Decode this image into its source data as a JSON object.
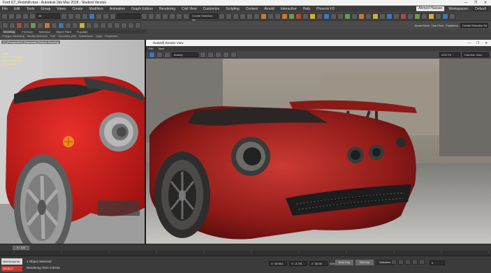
{
  "window": {
    "title": "Ford GT_Redshift.max - Autodesk 3ds Max 2018 - Student Version",
    "buttons": [
      "—",
      "❐",
      "✕"
    ]
  },
  "menu": {
    "items": [
      "File",
      "Edit",
      "Tools",
      "Group",
      "Views",
      "Create",
      "Modifiers",
      "Animation",
      "Graph Editors",
      "Rendering",
      "Civil View",
      "Customize",
      "Scripting",
      "Content",
      "Arnold",
      "Interactive",
      "Help",
      "Phoenix FD"
    ],
    "user": "Ahmed Hassan",
    "workspaces_label": "Workspaces:",
    "workspace": "Default"
  },
  "toolbar": {
    "selection_filter": "All",
    "view_dropdown": "Create Selection Se"
  },
  "toolbar2": {
    "right_labels": [
      "Smart Move",
      "Use Pivot",
      "PolyMenu"
    ],
    "selection_set": "Create Selection Se"
  },
  "ribbon": {
    "tabs": [
      "Modeling",
      "Freeform",
      "Selection",
      "Object Paint",
      "Populate"
    ],
    "sub": [
      "Polygon Modeling",
      "Modify Selection",
      "Edit",
      "Geometry (All)",
      "Subdivision",
      "Align",
      "Properties"
    ]
  },
  "left_viewport": {
    "label": "[+] [Perspective] [Standard] [Default Shading]",
    "stats": [
      "Total",
      "Polys: 4,185,963",
      "Verts: 2,186,451",
      "FPS: 3.911"
    ]
  },
  "render_window": {
    "title": "Redshift Render View",
    "buttons": [
      "—",
      "❐",
      "✕"
    ],
    "menu": [
      "File",
      "View"
    ],
    "dropdown_left": "Beauty",
    "dropdown_right1": "AOV Fit",
    "dropdown_right2": "Camera: Cam"
  },
  "timeline": {
    "slider": "0 / 100"
  },
  "status": {
    "maxscript": "MAXScript Mi",
    "maxscript_red": "OBJECT",
    "line1": "1 Object Selected",
    "line2": "Rendering Time  0:00:01",
    "x": "X: 35.664",
    "y": "Y: -3.791",
    "z": "Z: 26.08",
    "grid": "Grid = 10.0",
    "autokey": "Auto Key",
    "setkey": "Set Key",
    "selected": "Selected",
    "frame": "0"
  },
  "colors": {
    "accent": "#3d78b8",
    "car_red": "#c41d1d"
  }
}
